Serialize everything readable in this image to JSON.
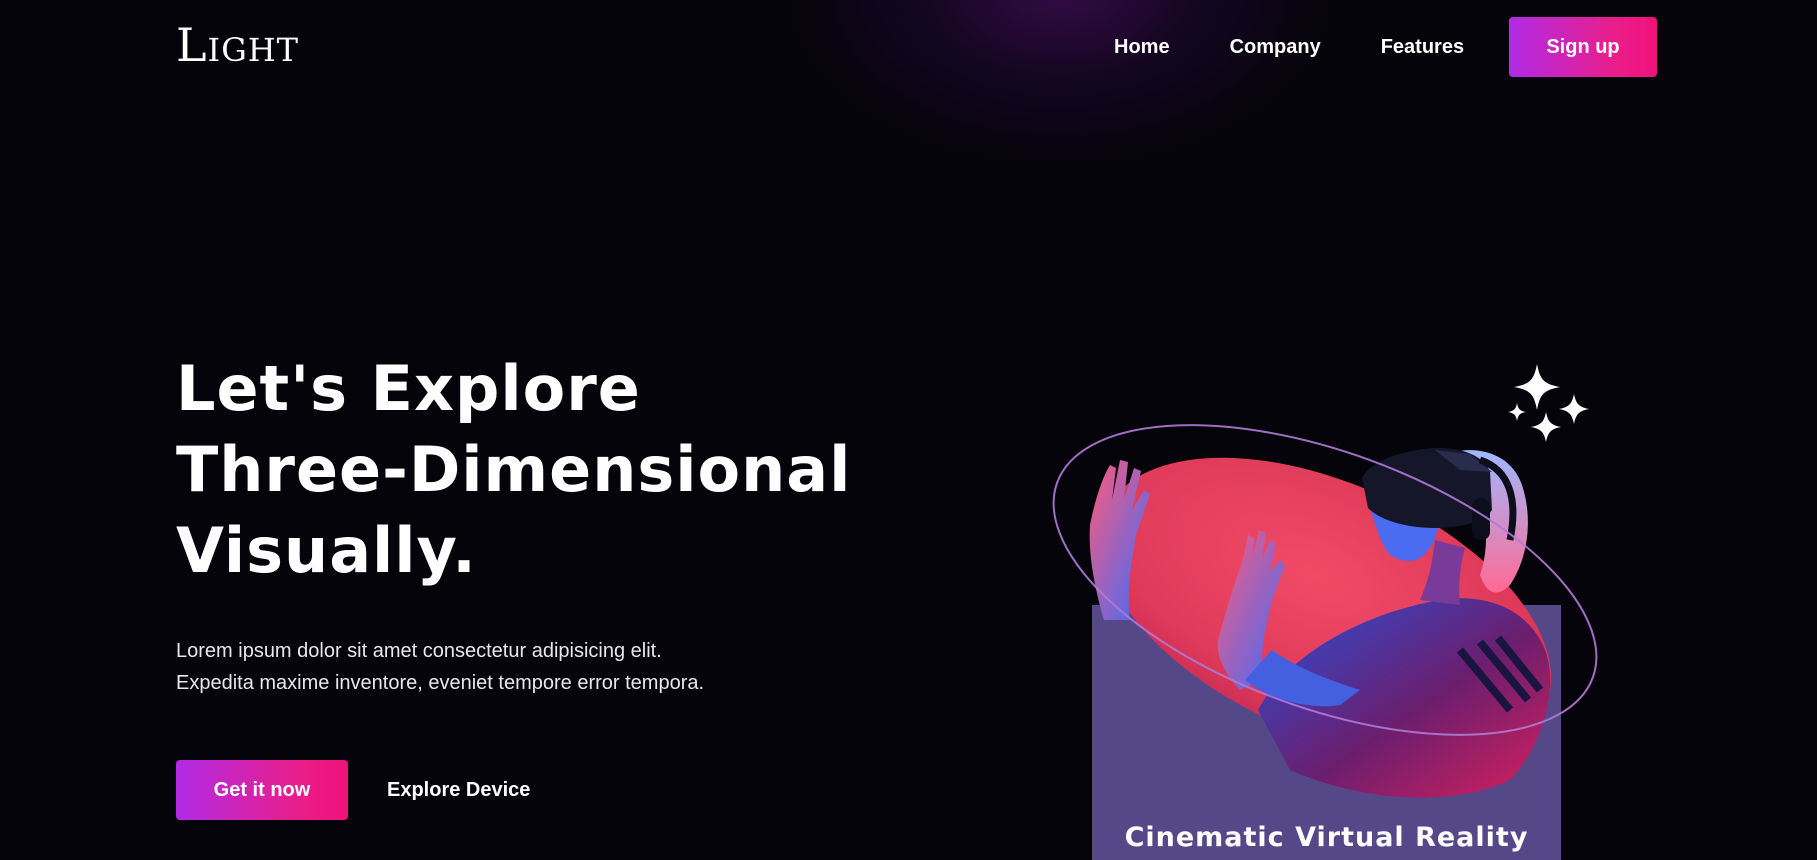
{
  "header": {
    "logo_text": "Light",
    "nav": [
      "Home",
      "Company",
      "Features"
    ],
    "signup_label": "Sign up"
  },
  "hero": {
    "title_lines": [
      "Let's Explore",
      "Three-Dimensional",
      "Visually."
    ],
    "description_lines": [
      "Lorem ipsum dolor sit amet consectetur adipisicing elit.",
      "Expedita maxime inventore, eveniet tempore error tempora."
    ],
    "primary_cta": "Get it now",
    "secondary_cta": "Explore Device"
  },
  "visual": {
    "caption": "Cinematic Virtual Reality",
    "icons": [
      "sparkles-icon"
    ],
    "colors": {
      "card": "#544888",
      "blob": "#e8405e",
      "orbit": "#b07ad6",
      "accent_start": "#b12be6",
      "accent_end": "#f0127a"
    }
  }
}
